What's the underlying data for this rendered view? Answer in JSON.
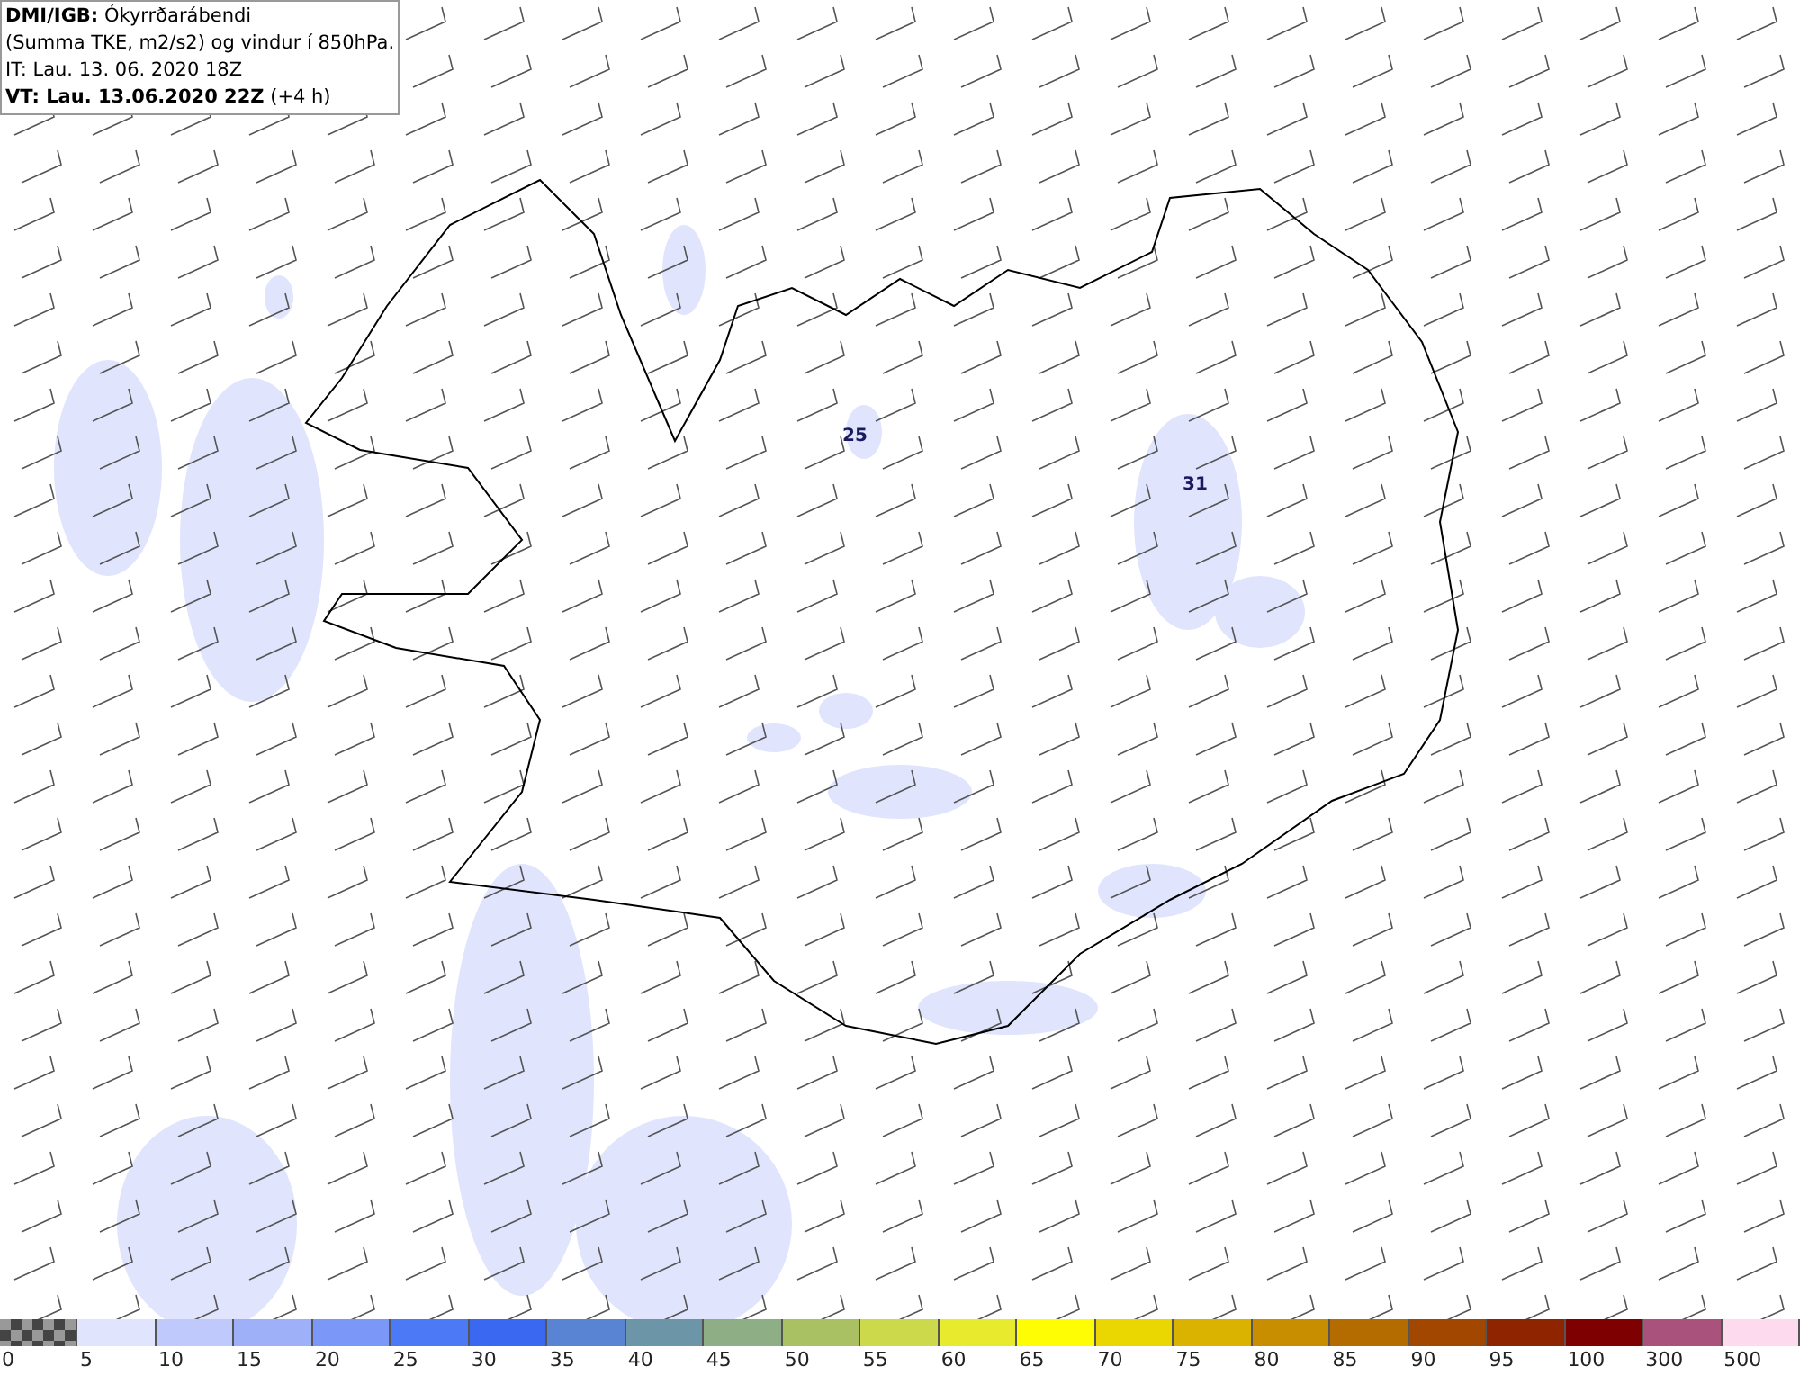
{
  "title_box": {
    "lines": [
      "**DMI/IGB:** Ókyrrðarábendi",
      "(Summa TKE, m2/s2) og vindur í 850hPa.",
      "IT: Lau. 13. 06. 2020 18Z",
      "**VT: Lau. 13.06.2020 22Z** (+4 h)"
    ]
  },
  "map": {
    "labels": [
      "25",
      "31"
    ]
  },
  "legend": [
    {
      "value": "0",
      "kind": "checker"
    },
    {
      "value": "5",
      "kind": "solid",
      "color": "#e1e4fd"
    },
    {
      "value": "10",
      "kind": "solid",
      "color": "#bfc9fb"
    },
    {
      "value": "15",
      "kind": "solid",
      "color": "#9eb1f8"
    },
    {
      "value": "20",
      "kind": "solid",
      "color": "#7b98f8"
    },
    {
      "value": "25",
      "kind": "solid",
      "color": "#4c79f6"
    },
    {
      "value": "30",
      "kind": "solid",
      "color": "#3a68f0"
    },
    {
      "value": "35",
      "kind": "solid",
      "color": "#5983d3"
    },
    {
      "value": "40",
      "kind": "solid",
      "color": "#6c96a8"
    },
    {
      "value": "45",
      "kind": "solid",
      "color": "#8eaf85"
    },
    {
      "value": "50",
      "kind": "solid",
      "color": "#a9c063"
    },
    {
      "value": "55",
      "kind": "solid",
      "color": "#cbd94a"
    },
    {
      "value": "60",
      "kind": "solid",
      "color": "#e8ea2e"
    },
    {
      "value": "65",
      "kind": "solid",
      "color": "#fefd03"
    },
    {
      "value": "70",
      "kind": "solid",
      "color": "#ead600"
    },
    {
      "value": "75",
      "kind": "solid",
      "color": "#dab200"
    },
    {
      "value": "80",
      "kind": "solid",
      "color": "#c98e00"
    },
    {
      "value": "85",
      "kind": "solid",
      "color": "#b46b00"
    },
    {
      "value": "90",
      "kind": "solid",
      "color": "#a24700"
    },
    {
      "value": "95",
      "kind": "solid",
      "color": "#8f2500"
    },
    {
      "value": "100",
      "kind": "solid",
      "color": "#7e0000"
    },
    {
      "value": "300",
      "kind": "solid",
      "color": "#a8527c"
    },
    {
      "value": "500",
      "kind": "solid",
      "color": "#fddaee"
    }
  ]
}
